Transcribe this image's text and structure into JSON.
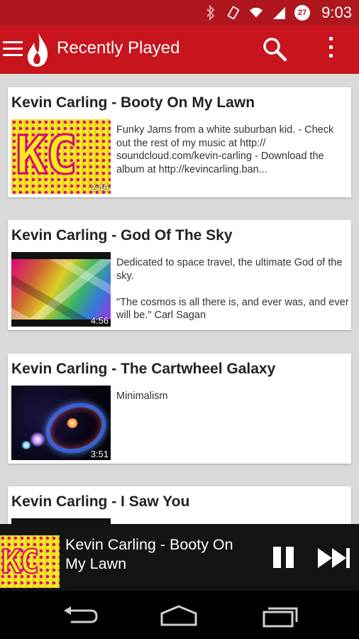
{
  "status_bar": {
    "time": "9:03",
    "notification_count": "27",
    "icons": [
      "bluetooth-icon",
      "vibrate-icon",
      "wifi-icon",
      "signal-icon",
      "battery-icon"
    ]
  },
  "app_bar": {
    "title": "Recently Played",
    "icons": [
      "menu-icon",
      "flame-logo-icon",
      "search-icon",
      "overflow-menu-icon"
    ],
    "colors": {
      "status": "#b0161e",
      "toolbar": "#c8141d"
    }
  },
  "videos": [
    {
      "title": "Kevin Carling - Booty On My Lawn",
      "duration": "2:49",
      "description": "Funky Jams from a white suburban kid. - Check out the rest of my music at http:// soundcloud.com/kevin-carling - Download the album at http://kevincarling.ban..."
    },
    {
      "title": "Kevin Carling - God Of The Sky",
      "duration": "4:56",
      "description": "Dedicated to space travel, the ultimate God of the sky.\n\n\"The cosmos is all there is, and ever was, and ever will be.\"  Carl Sagan"
    },
    {
      "title": "Kevin Carling - The Cartwheel Galaxy",
      "duration": "3:51",
      "description": "Minimalism"
    },
    {
      "title": "Kevin Carling - I Saw You",
      "duration": "",
      "description": ""
    }
  ],
  "thumbnail_text": "KC",
  "now_playing": {
    "title": "Kevin Carling - Booty On My Lawn",
    "controls": [
      "pause-icon",
      "skip-next-icon"
    ]
  },
  "nav_bar": {
    "buttons": [
      "back-icon",
      "home-icon",
      "recent-apps-icon"
    ]
  }
}
